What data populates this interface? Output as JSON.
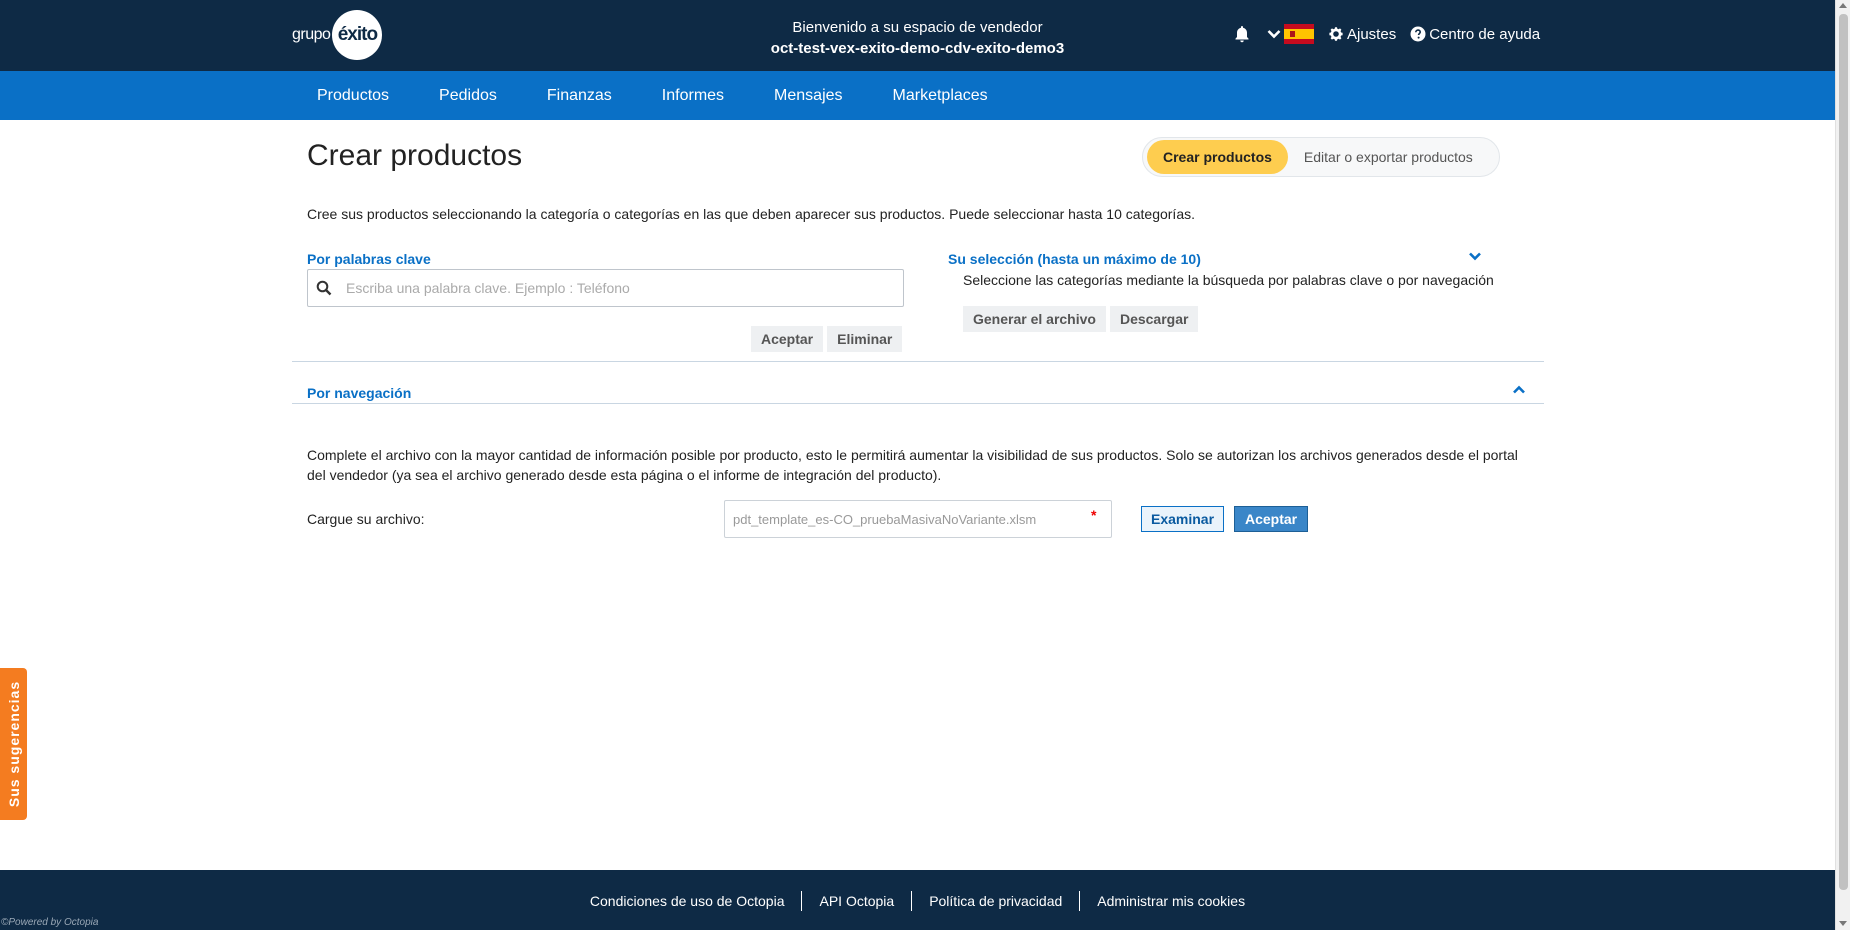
{
  "header": {
    "logo_prefix": "grupo",
    "logo_mark": "éxito",
    "welcome": "Bienvenido a su espacio de vendedor",
    "shop_name": "oct-test-vex-exito-demo-cdv-exito-demo3",
    "settings_label": "Ajustes",
    "help_label": "Centro de ayuda",
    "icons": [
      "bell-icon",
      "chevron-down-icon",
      "spain-flag-icon",
      "gear-icon",
      "help-circle-icon"
    ]
  },
  "nav": {
    "items": [
      {
        "label": "Productos"
      },
      {
        "label": "Pedidos"
      },
      {
        "label": "Finanzas"
      },
      {
        "label": "Informes"
      },
      {
        "label": "Mensajes"
      },
      {
        "label": "Marketplaces"
      }
    ]
  },
  "page": {
    "title": "Crear productos",
    "toggle": {
      "active": "Crear productos",
      "inactive": "Editar o exportar productos"
    },
    "intro": "Cree sus productos seleccionando la categoría o categorías en las que deben aparecer sus productos. Puede seleccionar hasta 10 categorías."
  },
  "keywords": {
    "label": "Por palabras clave",
    "placeholder": "Escriba una palabra clave. Ejemplo : Teléfono",
    "value": "",
    "accept": "Aceptar",
    "delete": "Eliminar"
  },
  "selection": {
    "label": "Su selección (hasta un máximo de 10)",
    "hint": "Seleccione las categorías mediante la búsqueda por palabras clave o por navegación",
    "generate": "Generar el archivo",
    "download": "Descargar"
  },
  "navigation": {
    "label": "Por navegación"
  },
  "upload": {
    "info": "Complete el archivo con la mayor cantidad de información posible por producto, esto le permitirá aumentar la visibilidad de sus productos. Solo se autorizan los archivos generados desde el portal del vendedor (ya sea el archivo generado desde esta página o el informe de integración del producto).",
    "label": "Cargue su archivo:",
    "file_name": "pdt_template_es-CO_pruebaMasivaNoVariante.xlsm",
    "required_mark": "*",
    "browse": "Examinar",
    "accept": "Aceptar"
  },
  "feedback": {
    "label": "Sus sugerencias"
  },
  "footer": {
    "links": [
      {
        "label": "Condiciones de uso de Octopia"
      },
      {
        "label": "API Octopia"
      },
      {
        "label": "Política de privacidad"
      },
      {
        "label": "Administrar mis cookies"
      }
    ],
    "powered": "©Powered by Octopia"
  },
  "colors": {
    "header_bg": "#0e2a45",
    "nav_bg": "#0a70c6",
    "accent_yellow": "#fecd4f",
    "feedback_orange": "#f47c20"
  }
}
